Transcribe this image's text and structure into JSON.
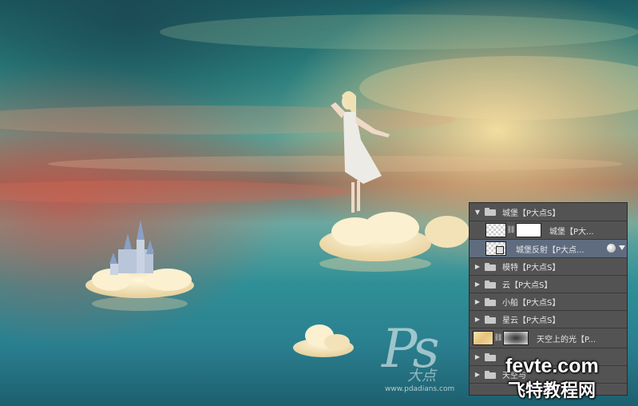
{
  "layers_panel": {
    "rows": [
      {
        "label": "城堡【P大点S】",
        "type": "group",
        "expanded": true
      },
      {
        "label": "城堡【P大...",
        "type": "layer-with-mask"
      },
      {
        "label": "城堡反射【P大点...",
        "type": "smart-object",
        "selected": true
      },
      {
        "label": "模特【P大点S】",
        "type": "group"
      },
      {
        "label": "云【P大点S】",
        "type": "group"
      },
      {
        "label": "小船【P大点S】",
        "type": "group"
      },
      {
        "label": "星云【P大点S】",
        "type": "group"
      },
      {
        "label": "天空上的光【P...",
        "type": "layer-with-mask"
      },
      {
        "label": "",
        "type": "group"
      },
      {
        "label": "天空与",
        "type": "group"
      }
    ]
  },
  "watermarks": {
    "ps_logo": "Ps",
    "ps_cn": "大点",
    "ps_url": "www.pdadians.com",
    "fevte": "fevte.com",
    "fevte_cn": "飞特教程网"
  },
  "colors": {
    "panel_bg": "#535353",
    "selected_row": "#5f6c80"
  }
}
